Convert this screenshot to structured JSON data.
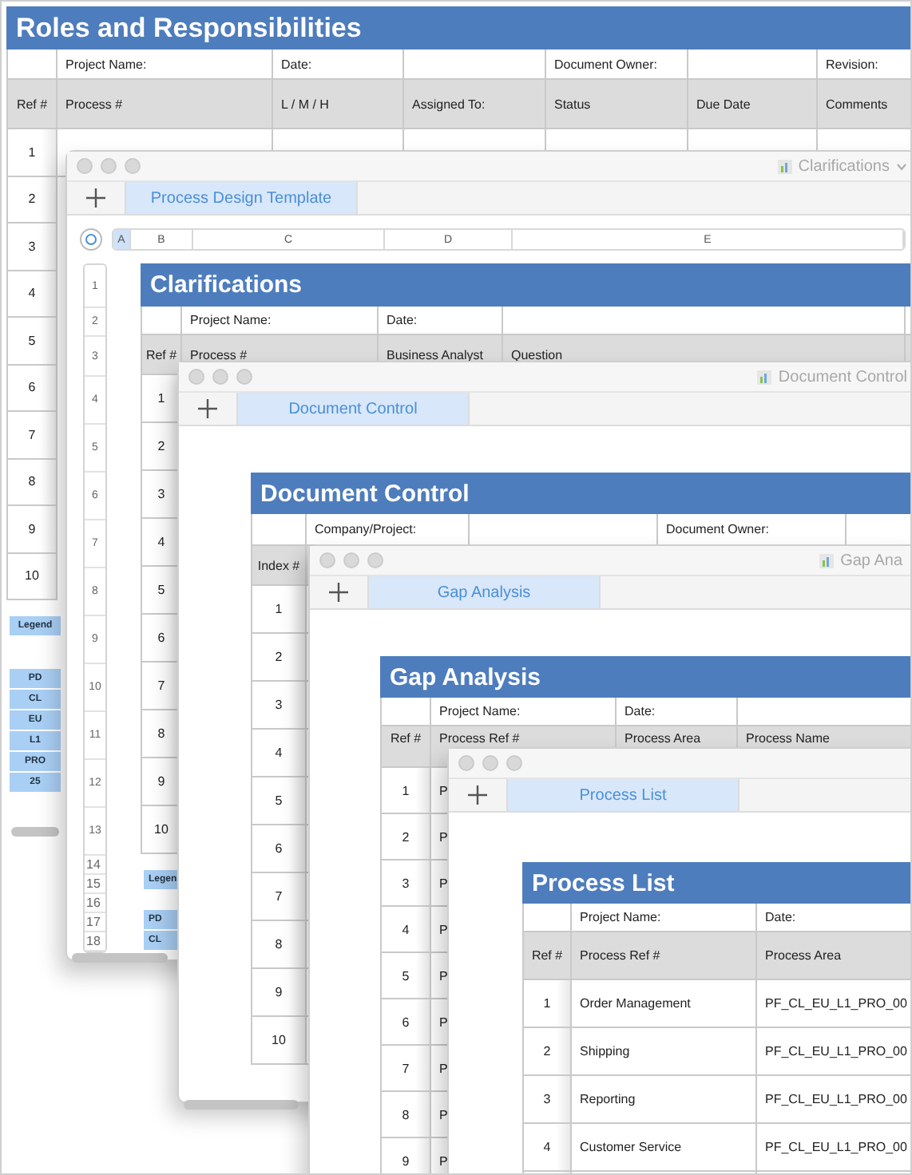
{
  "windows": [
    {
      "kind": "sheet",
      "sheet": {
        "title": "Roles and Responsibilities",
        "info": [
          "Project Name:",
          "Date:",
          "Document Owner:",
          "Revision:"
        ],
        "header": [
          "Ref #",
          "Process #",
          "L / M / H",
          "Assigned To:",
          "Status",
          "Due Date",
          "Comments"
        ],
        "rows": [
          [
            "1"
          ],
          [
            "2"
          ],
          [
            "3"
          ],
          [
            "4"
          ],
          [
            "5"
          ],
          [
            "6"
          ],
          [
            "7"
          ],
          [
            "8"
          ],
          [
            "9"
          ],
          [
            "10"
          ]
        ]
      },
      "legend": [
        "Legend",
        "PD",
        "CL",
        "EU",
        "L1",
        "PRO",
        "25"
      ]
    },
    {
      "kind": "window",
      "title": "Clarifications",
      "menu": true,
      "tab": "Process Design Template",
      "grid": {
        "columns": [
          {
            "label": "A",
            "selected": true
          },
          {
            "label": "B",
            "selected": false
          },
          {
            "label": "C",
            "selected": false
          },
          {
            "label": "D",
            "selected": false
          },
          {
            "label": "E",
            "selected": false
          }
        ],
        "rows": [
          "1",
          "2",
          "3",
          "4",
          "5",
          "6",
          "7",
          "8",
          "9",
          "10",
          "11",
          "12",
          "13",
          "14",
          "15",
          "16",
          "17",
          "18"
        ]
      },
      "sheet": {
        "title": "Clarifications",
        "info": [
          "Project Name:",
          "Date:"
        ],
        "header": [
          "Ref #",
          "Process #",
          "Business Analyst",
          "Question"
        ],
        "rows": [
          [
            "1"
          ],
          [
            "2"
          ],
          [
            "3"
          ],
          [
            "4"
          ],
          [
            "5"
          ],
          [
            "6"
          ],
          [
            "7"
          ],
          [
            "8"
          ],
          [
            "9"
          ],
          [
            "10"
          ]
        ]
      },
      "legend": [
        "Legen",
        "PD",
        "CL"
      ]
    },
    {
      "kind": "window",
      "title": "Document Control",
      "menu": false,
      "tab": "Document Control",
      "sheet": {
        "title": "Document Control",
        "info": [
          "Company/Project:",
          "Document Owner:"
        ],
        "header": [
          "Index #"
        ],
        "rows": [
          [
            "1"
          ],
          [
            "2"
          ],
          [
            "3"
          ],
          [
            "4"
          ],
          [
            "5"
          ],
          [
            "6"
          ],
          [
            "7"
          ],
          [
            "8"
          ],
          [
            "9"
          ],
          [
            "10"
          ]
        ]
      }
    },
    {
      "kind": "window",
      "title": "Gap Ana",
      "menu": false,
      "tab": "Gap Analysis",
      "sheet": {
        "title": "Gap Analysis",
        "info": [
          "Project Name:",
          "Date:"
        ],
        "header": [
          "Ref #",
          "Process Ref #",
          "Process Area",
          "Process Name"
        ],
        "rows": [
          [
            "1",
            "P"
          ],
          [
            "2",
            "P"
          ],
          [
            "3",
            "P"
          ],
          [
            "4",
            "P"
          ],
          [
            "5",
            "P"
          ],
          [
            "6",
            "P"
          ],
          [
            "7",
            "P"
          ],
          [
            "8",
            "P"
          ],
          [
            "9",
            "P"
          ]
        ]
      }
    },
    {
      "kind": "window",
      "menu": false,
      "tab": "Process List",
      "sheet": {
        "title": "Process List",
        "info": [
          "Project Name:",
          "Date:"
        ],
        "header": [
          "Ref #",
          "Process Ref #",
          "Process Area"
        ],
        "rows": [
          [
            "1",
            "Order Management",
            "PF_CL_EU_L1_PRO_00"
          ],
          [
            "2",
            "Shipping",
            "PF_CL_EU_L1_PRO_00"
          ],
          [
            "3",
            "Reporting",
            "PF_CL_EU_L1_PRO_00"
          ],
          [
            "4",
            "Customer Service",
            "PF_CL_EU_L1_PRO_00"
          ],
          []
        ]
      }
    }
  ]
}
